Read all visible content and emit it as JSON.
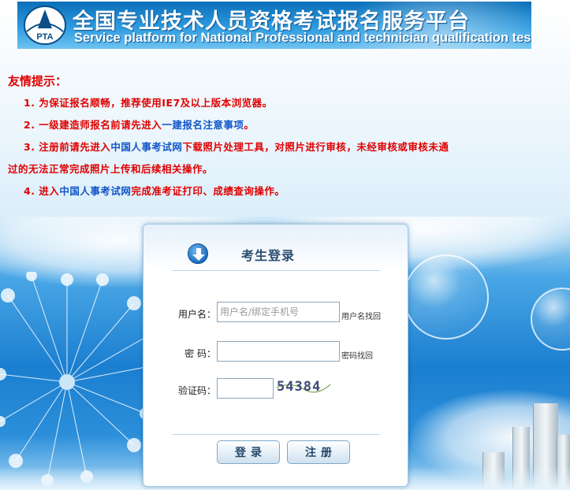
{
  "banner": {
    "logo_text": "PTA",
    "title": "全国专业技术人员资格考试报名服务平台",
    "subtitle": "Service platform for National Professional and technician qualification test"
  },
  "tips": {
    "title": "友情提示：",
    "items": [
      {
        "parts": [
          "1. 为保证报名顺畅，推荐使用IE7及以上版本浏览器。"
        ]
      },
      {
        "pre": "2. 一级建造师报名前请先进入",
        "link": "一建报名注意事项",
        "post": "。"
      },
      {
        "pre": "3. 注册前请先进入",
        "link": "中国人事考试网",
        "post": "下载照片处理工具，对照片进行审核，未经审核或审核未通",
        "cont": "过的无法正常完成照片上传和后续相关操作。"
      },
      {
        "pre": "4. 进入",
        "link": "中国人事考试网",
        "post": "完成准考证打印、成绩查询操作。"
      }
    ]
  },
  "login": {
    "title": "考生登录",
    "username_label": "用户名：",
    "username_placeholder": "用户名/绑定手机号",
    "username_value": "",
    "username_help": "用户名找回",
    "password_label": "密 码：",
    "password_value": "",
    "password_help": "密码找回",
    "captcha_label": "验证码：",
    "captcha_value": "",
    "captcha_text": "54384",
    "login_button": "登录",
    "register_button": "注册"
  },
  "colors": {
    "tip_red": "#e00000",
    "link_blue": "#1055c8",
    "banner_blue": "#0a6fb8"
  }
}
